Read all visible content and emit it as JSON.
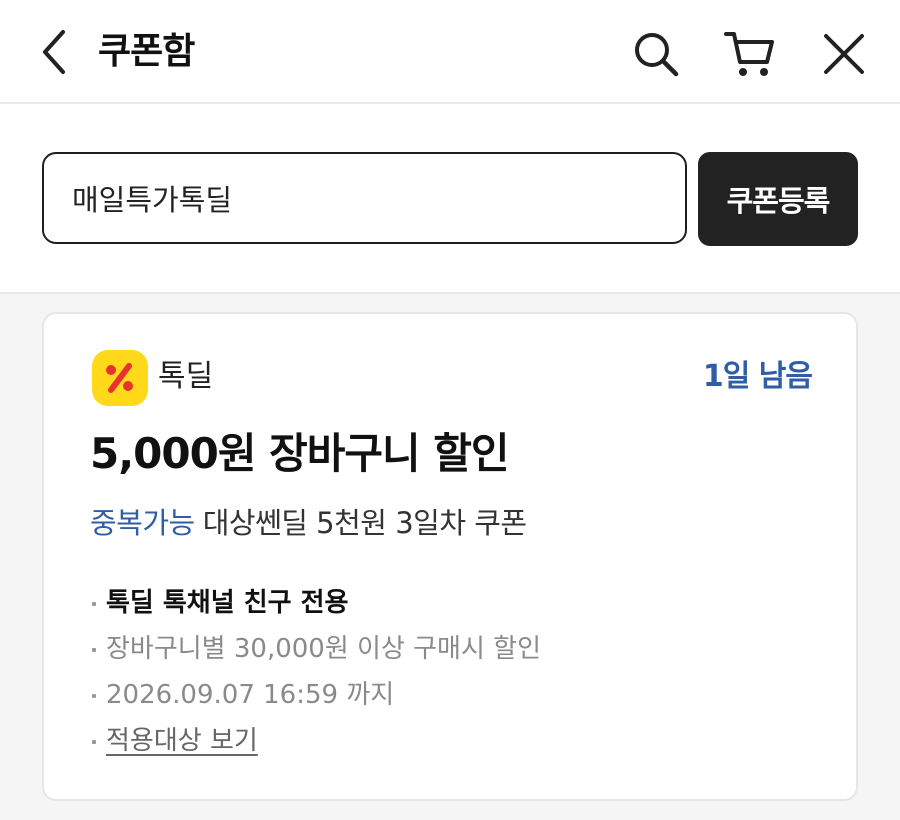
{
  "header": {
    "title": "쿠폰함",
    "icons": [
      "back-arrow-icon",
      "search-icon",
      "cart-icon",
      "close-icon"
    ]
  },
  "coupon_code": {
    "value": "매일특가톡딜",
    "register_label": "쿠폰등록"
  },
  "coupon": {
    "brand": "톡딜",
    "brand_color": "#ffd91a",
    "days_left": "1일 남음",
    "title": "5,000원 장바구니 할인",
    "stackable": "중복가능",
    "description": "대상쎈딜 5천원 3일차 쿠폰",
    "details": {
      "exclusive": "톡딜 톡채널 친구 전용",
      "condition": "장바구니별 30,000원 이상 구매시 할인",
      "expiry": "2026.09.07 16:59 까지",
      "view_targets": "적용대상 보기"
    }
  },
  "colors": {
    "accent_blue": "#2f5ea6",
    "button_dark": "#222222"
  }
}
